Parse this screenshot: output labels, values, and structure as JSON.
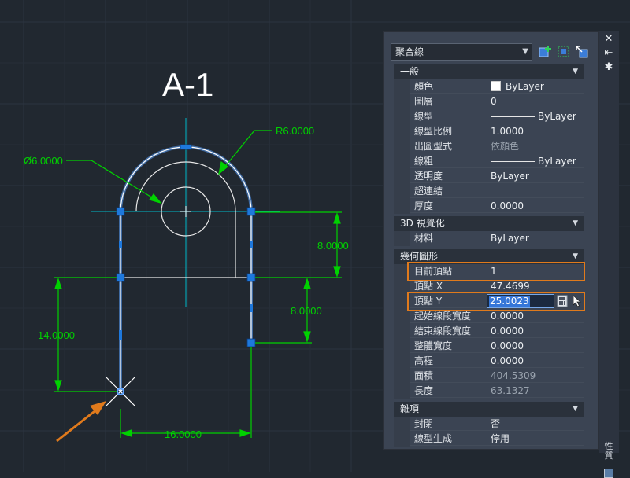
{
  "drawing": {
    "title": "A-1",
    "dims": {
      "diameter": "Ø6.0000",
      "radius": "R6.0000",
      "right_upper": "8.0000",
      "right_lower": "8.0000",
      "left_height": "14.0000",
      "bottom_width": "16.0000"
    }
  },
  "palette": {
    "object_type": "聚合線",
    "toolbar_icons": [
      "select-objects-icon",
      "quick-select-icon",
      "toggle-pickadd-icon"
    ],
    "side_strip": {
      "close": "✕",
      "autohide": "⇤",
      "menu": "✱",
      "title": "性質"
    },
    "sections": {
      "general": {
        "title": "一般",
        "rows": [
          {
            "label": "顏色",
            "value": "ByLayer"
          },
          {
            "label": "圖層",
            "value": "0"
          },
          {
            "label": "線型",
            "value": "ByLayer"
          },
          {
            "label": "線型比例",
            "value": "1.0000"
          },
          {
            "label": "出圖型式",
            "value": "依顏色"
          },
          {
            "label": "線粗",
            "value": "ByLayer"
          },
          {
            "label": "透明度",
            "value": "ByLayer"
          },
          {
            "label": "超連結",
            "value": ""
          },
          {
            "label": "厚度",
            "value": "0.0000"
          }
        ]
      },
      "visual3d": {
        "title": "3D 視覺化",
        "rows": [
          {
            "label": "材料",
            "value": "ByLayer"
          }
        ]
      },
      "geometry": {
        "title": "幾何圖形",
        "rows": [
          {
            "label": "目前頂點",
            "value": "1"
          },
          {
            "label": "頂點 X",
            "value": "47.4699"
          },
          {
            "label": "頂點 Y",
            "value": "25.0023"
          },
          {
            "label": "起始線段寬度",
            "value": "0.0000"
          },
          {
            "label": "結束線段寬度",
            "value": "0.0000"
          },
          {
            "label": "整體寬度",
            "value": "0.0000"
          },
          {
            "label": "高程",
            "value": "0.0000"
          },
          {
            "label": "面積",
            "value": "404.5309"
          },
          {
            "label": "長度",
            "value": "63.1327"
          }
        ]
      },
      "misc": {
        "title": "雜項",
        "rows": [
          {
            "label": "封閉",
            "value": "否"
          },
          {
            "label": "線型生成",
            "value": "停用"
          }
        ]
      }
    }
  },
  "colors": {
    "background": "#212830",
    "dimension": "#00d200",
    "selection_grip": "#1e78dc",
    "highlight": "#e07a1c"
  }
}
